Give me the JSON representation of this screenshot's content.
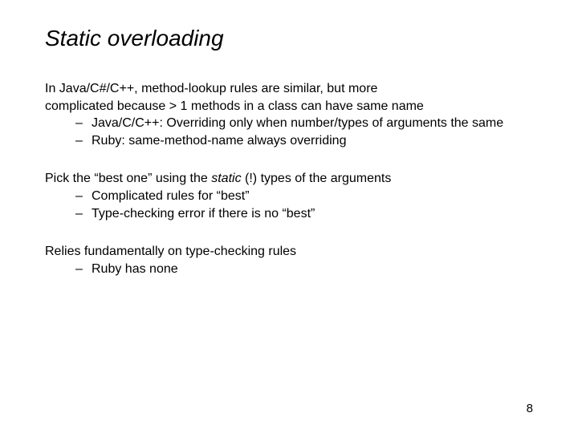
{
  "title": "Static overloading",
  "para1": {
    "line1": "In Java/C#/C++, method-lookup rules are similar, but more",
    "line2": "complicated because > 1 methods in a class can have same name",
    "bullets": [
      "Java/C/C++: Overriding only when number/types of arguments the same",
      "Ruby: same-method-name always overriding"
    ]
  },
  "para2": {
    "pre": "Pick the “best one” using the ",
    "italic": "static",
    "post": " (!) types of the arguments",
    "bullets": [
      "Complicated rules for “best”",
      "Type-checking error if there is no “best”"
    ]
  },
  "para3": {
    "text": "Relies fundamentally on type-checking rules",
    "bullets": [
      "Ruby has none"
    ]
  },
  "pageNumber": "8"
}
